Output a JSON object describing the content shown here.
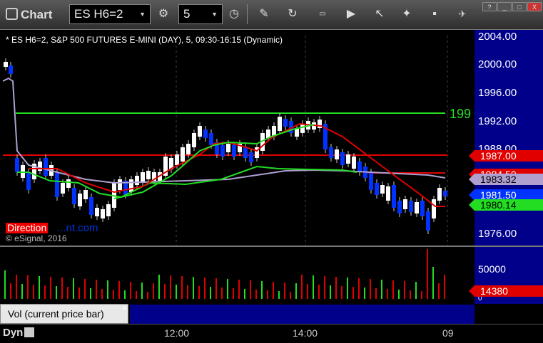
{
  "toolbar": {
    "title": "Chart",
    "symbol": "ES H6=2",
    "interval": "5",
    "buttons": [
      "clock-icon",
      "pencil-icon",
      "refresh-icon",
      "get-icon",
      "play-icon",
      "cursor-icon",
      "gift-icon",
      "pin-icon"
    ]
  },
  "window_buttons": {
    "help": "?",
    "minimize": "_",
    "maximize": "□",
    "close": "X"
  },
  "chart": {
    "legend": "* ES H6=2, S&P 500 FUTURES E-MINI (DAY), 5, 09:30-16:15 (Dynamic)",
    "watermark_brand": "Direction",
    "watermark_brand_rest": "...nt.com",
    "copyright": "© eSignal, 2016",
    "price_labels": [
      "2004.00",
      "2000.00",
      "1996.00",
      "1992.00",
      "1988.00",
      "1984.00",
      "1980.00",
      "1976.00"
    ],
    "tags": [
      {
        "text": "1987.00",
        "color": "#e00000",
        "textcolor": "#ffffff"
      },
      {
        "text": "1984.50",
        "color": "#e00000",
        "textcolor": "#ffffff"
      },
      {
        "text": "1983.32",
        "color": "#b0a0d0",
        "textcolor": "#000000"
      },
      {
        "text": "1981.50",
        "color": "#0033ff",
        "textcolor": "#ffffff"
      },
      {
        "text": "1980.14",
        "color": "#22dd22",
        "textcolor": "#000000"
      }
    ],
    "level_label": "199",
    "colors": {
      "green_level": "#22dd22",
      "red_level": "#e00000",
      "purple_ma": "#b0a0d0",
      "red_ma": "#e00000",
      "green_ma": "#22dd22",
      "up_candle": "#ffffff",
      "down_candle": "#0033ff",
      "background": "#000000",
      "axis_panel": "#00008b"
    }
  },
  "volume": {
    "study_label": "Vol (current price bar)",
    "close_glyph": "x",
    "axis_labels": [
      "50000",
      "0"
    ],
    "current_tag": "14380"
  },
  "time_axis": {
    "mode": "Dyn",
    "labels": [
      "12:00",
      "14:00",
      "09"
    ]
  }
}
